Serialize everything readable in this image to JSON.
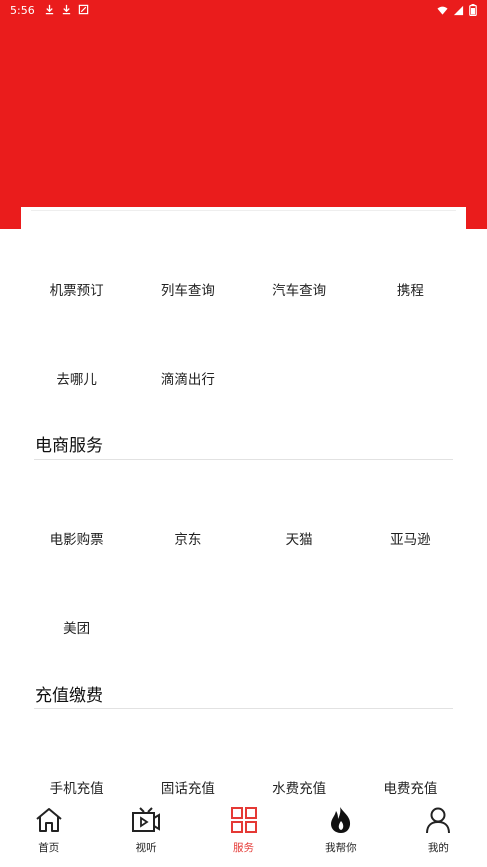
{
  "status_bar": {
    "time": "5:56",
    "left_icons": [
      "download-icon",
      "download-icon",
      "app-notification-icon"
    ],
    "right_icons": [
      "wifi-icon",
      "signal-icon",
      "battery-icon"
    ]
  },
  "colors": {
    "brand_red": "#ea1c1c",
    "tab_active": "#e53935",
    "tab_inactive": "#222222"
  },
  "travel": {
    "items": [
      {
        "label": "机票预订"
      },
      {
        "label": "列车查询"
      },
      {
        "label": "汽车查询"
      },
      {
        "label": "携程"
      },
      {
        "label": "去哪儿"
      },
      {
        "label": "滴滴出行"
      }
    ]
  },
  "ecommerce": {
    "title": "电商服务",
    "items": [
      {
        "label": "电影购票"
      },
      {
        "label": "京东"
      },
      {
        "label": "天猫"
      },
      {
        "label": "亚马逊"
      },
      {
        "label": "美团"
      }
    ]
  },
  "recharge": {
    "title": "充值缴费",
    "items": [
      {
        "label": "手机充值"
      },
      {
        "label": "固话充值"
      },
      {
        "label": "水费充值"
      },
      {
        "label": "电费充值"
      }
    ]
  },
  "tabbar": {
    "tabs": [
      {
        "label": "首页",
        "icon": "home-icon"
      },
      {
        "label": "视听",
        "icon": "video-camera-icon"
      },
      {
        "label": "服务",
        "icon": "grid-icon",
        "active": true
      },
      {
        "label": "我帮你",
        "icon": "flame-icon"
      },
      {
        "label": "我的",
        "icon": "person-icon"
      }
    ]
  }
}
